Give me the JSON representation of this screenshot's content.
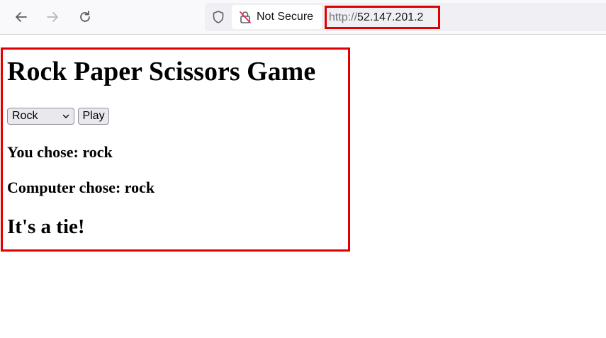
{
  "browser": {
    "security_label": "Not Secure",
    "url_scheme": "http://",
    "url_host": "52.147.201.2",
    "icons": {
      "back": "arrow-left-icon",
      "forward": "arrow-right-icon",
      "reload": "reload-icon",
      "tracking": "shield-icon",
      "insecure": "lock-slash-icon"
    },
    "highlight_color": "#e00000"
  },
  "page": {
    "title": "Rock Paper Scissors Game",
    "select": {
      "selected": "Rock"
    },
    "play_label": "Play",
    "you_chose": "You chose: rock",
    "computer_chose": "Computer chose: rock",
    "result": "It's a tie!"
  }
}
